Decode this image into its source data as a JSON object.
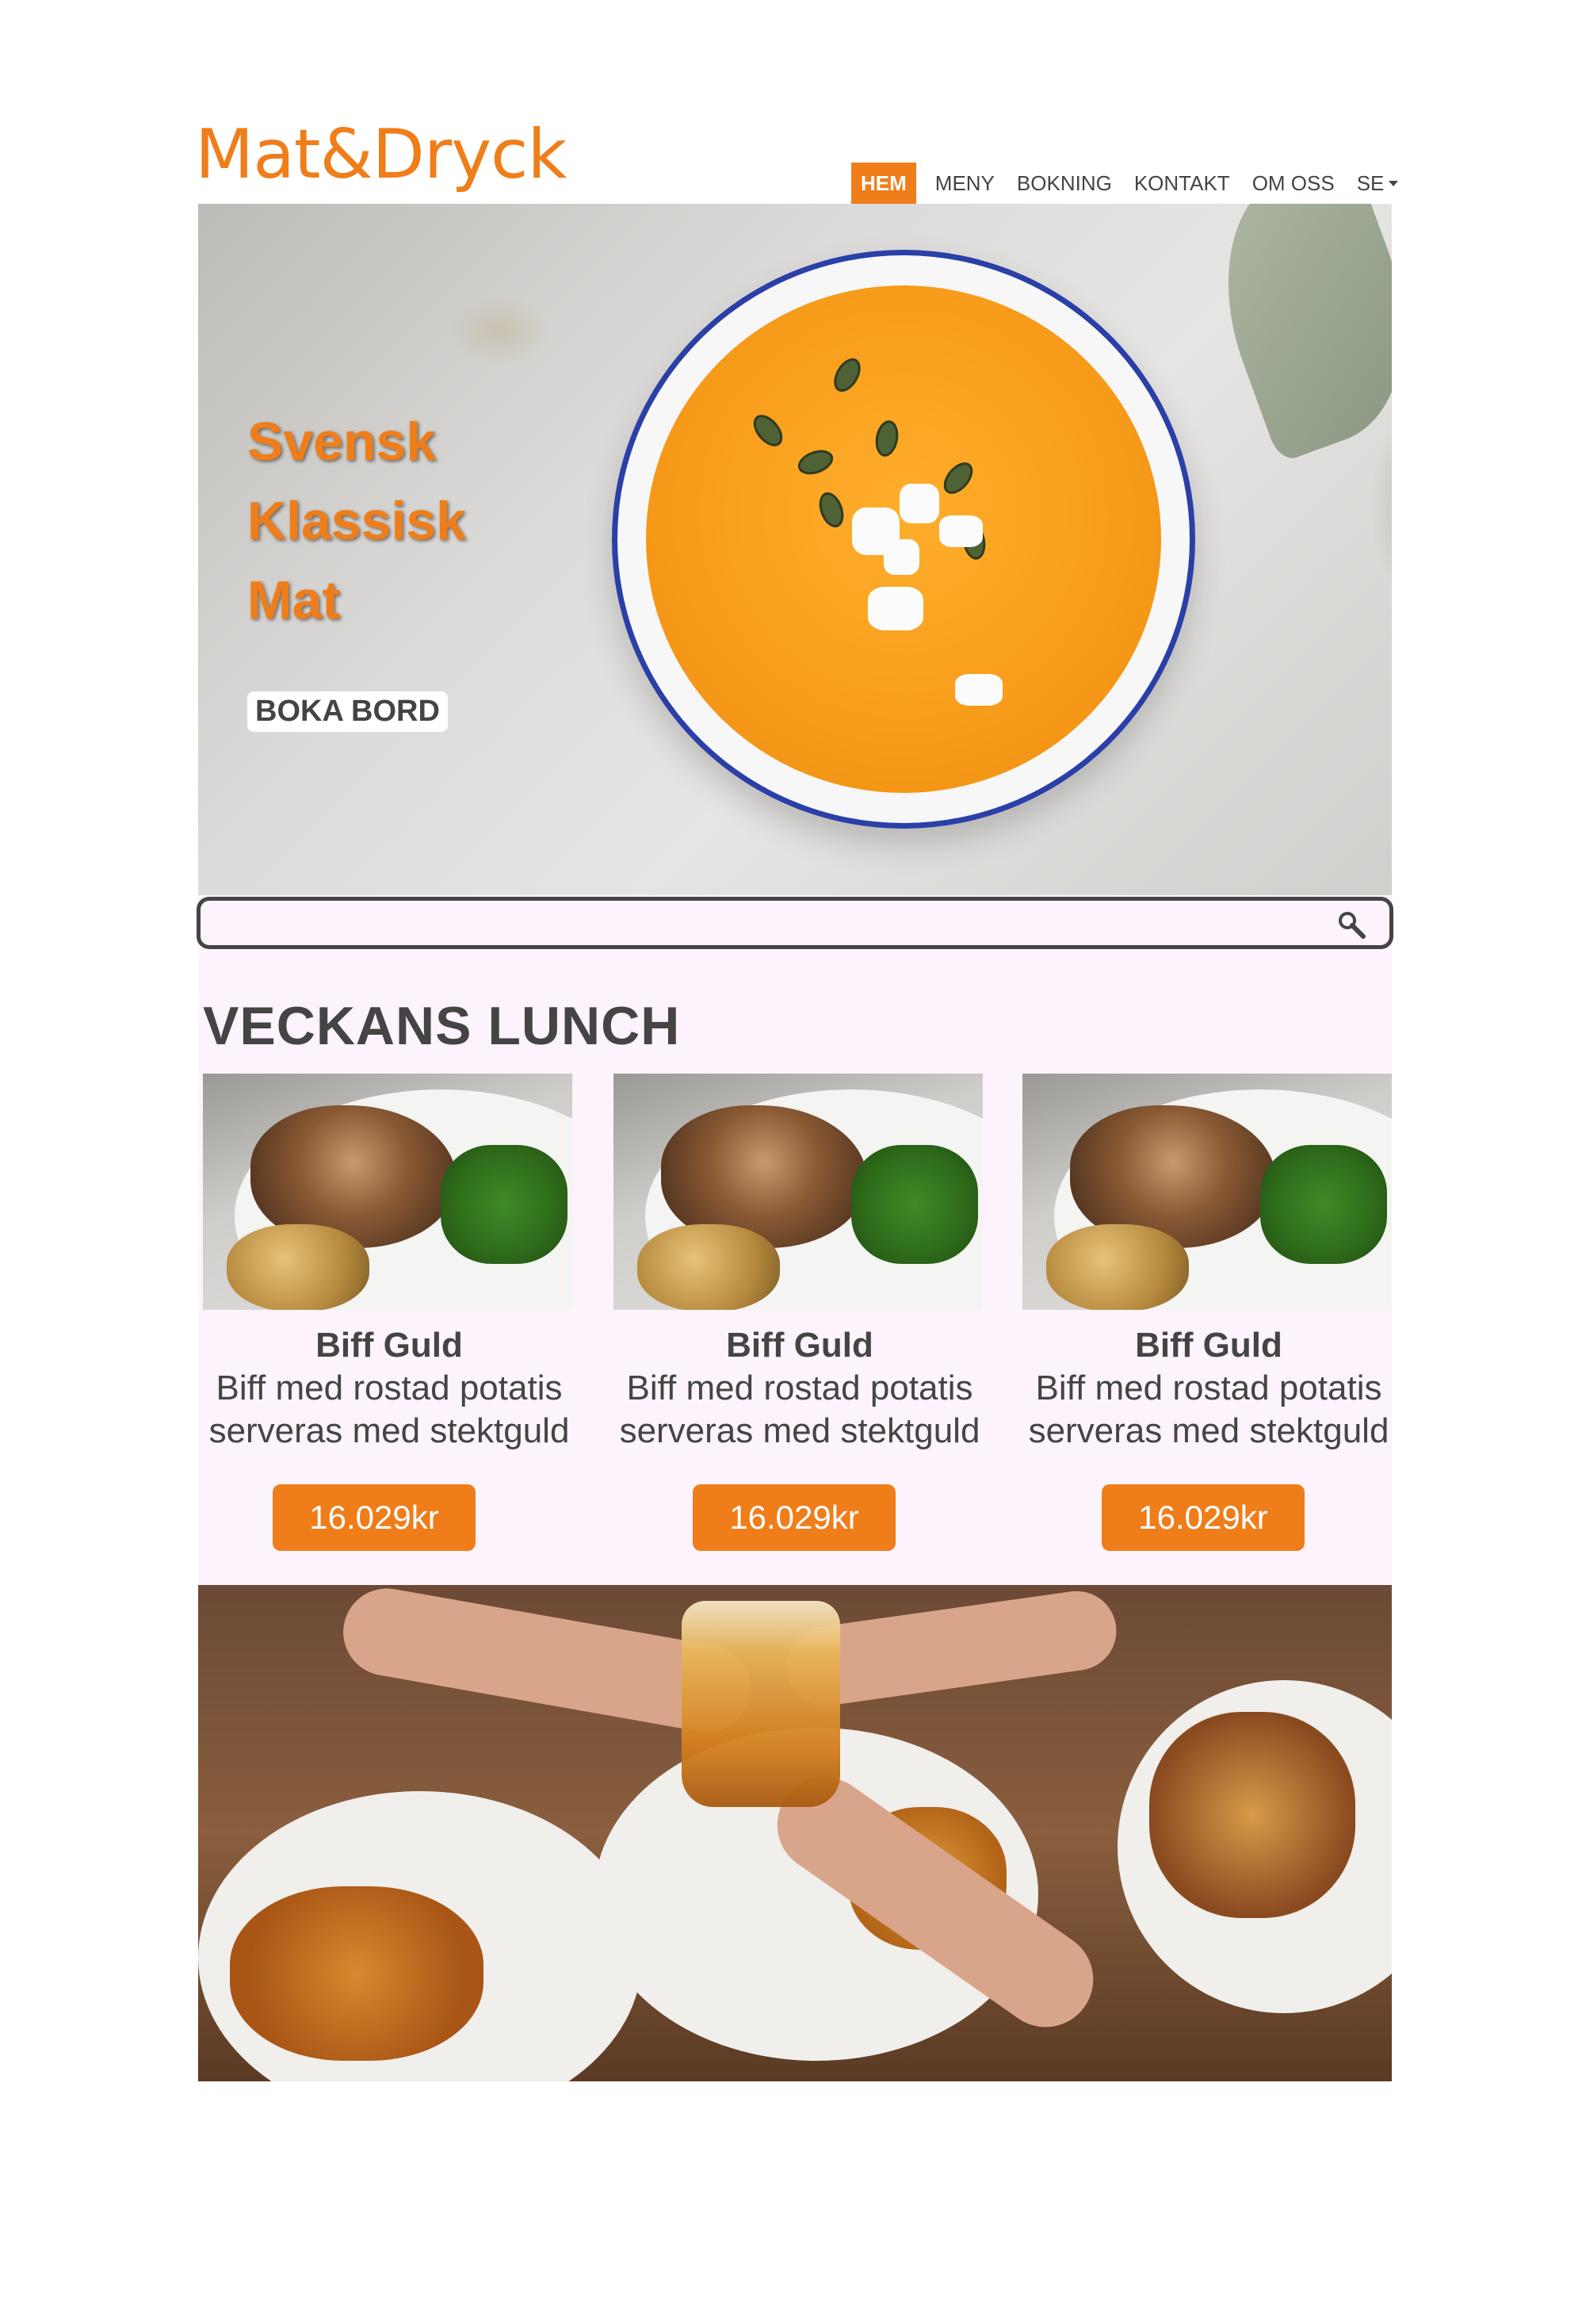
{
  "header": {
    "logo": "Mat&Dryck",
    "nav": [
      {
        "label": "HEM",
        "active": true
      },
      {
        "label": "MENY",
        "active": false
      },
      {
        "label": "BOKNING",
        "active": false
      },
      {
        "label": "KONTAKT",
        "active": false
      },
      {
        "label": "OM OSS",
        "active": false
      }
    ],
    "language": "SE"
  },
  "hero": {
    "title_lines": [
      "Svensk",
      "Klassisk",
      "Mat"
    ],
    "book_button": "BOKA BORD"
  },
  "search": {
    "icon": "search-icon"
  },
  "lunch": {
    "title": "VECKANS LUNCH",
    "cards": [
      {
        "name": "Biff Guld",
        "desc_line1": "Biff med rostad potatis",
        "desc_line2": "serveras med stektguld",
        "price": "16.029kr"
      },
      {
        "name": "Biff Guld",
        "desc_line1": "Biff med rostad potatis",
        "desc_line2": "serveras med stektguld",
        "price": "16.029kr"
      },
      {
        "name": "Biff Guld",
        "desc_line1": "Biff med rostad potatis",
        "desc_line2": "serveras med stektguld",
        "price": "16.029kr"
      }
    ]
  },
  "colors": {
    "accent": "#ef7e1a",
    "text": "#444444",
    "section_bg": "#fcf3fd"
  }
}
